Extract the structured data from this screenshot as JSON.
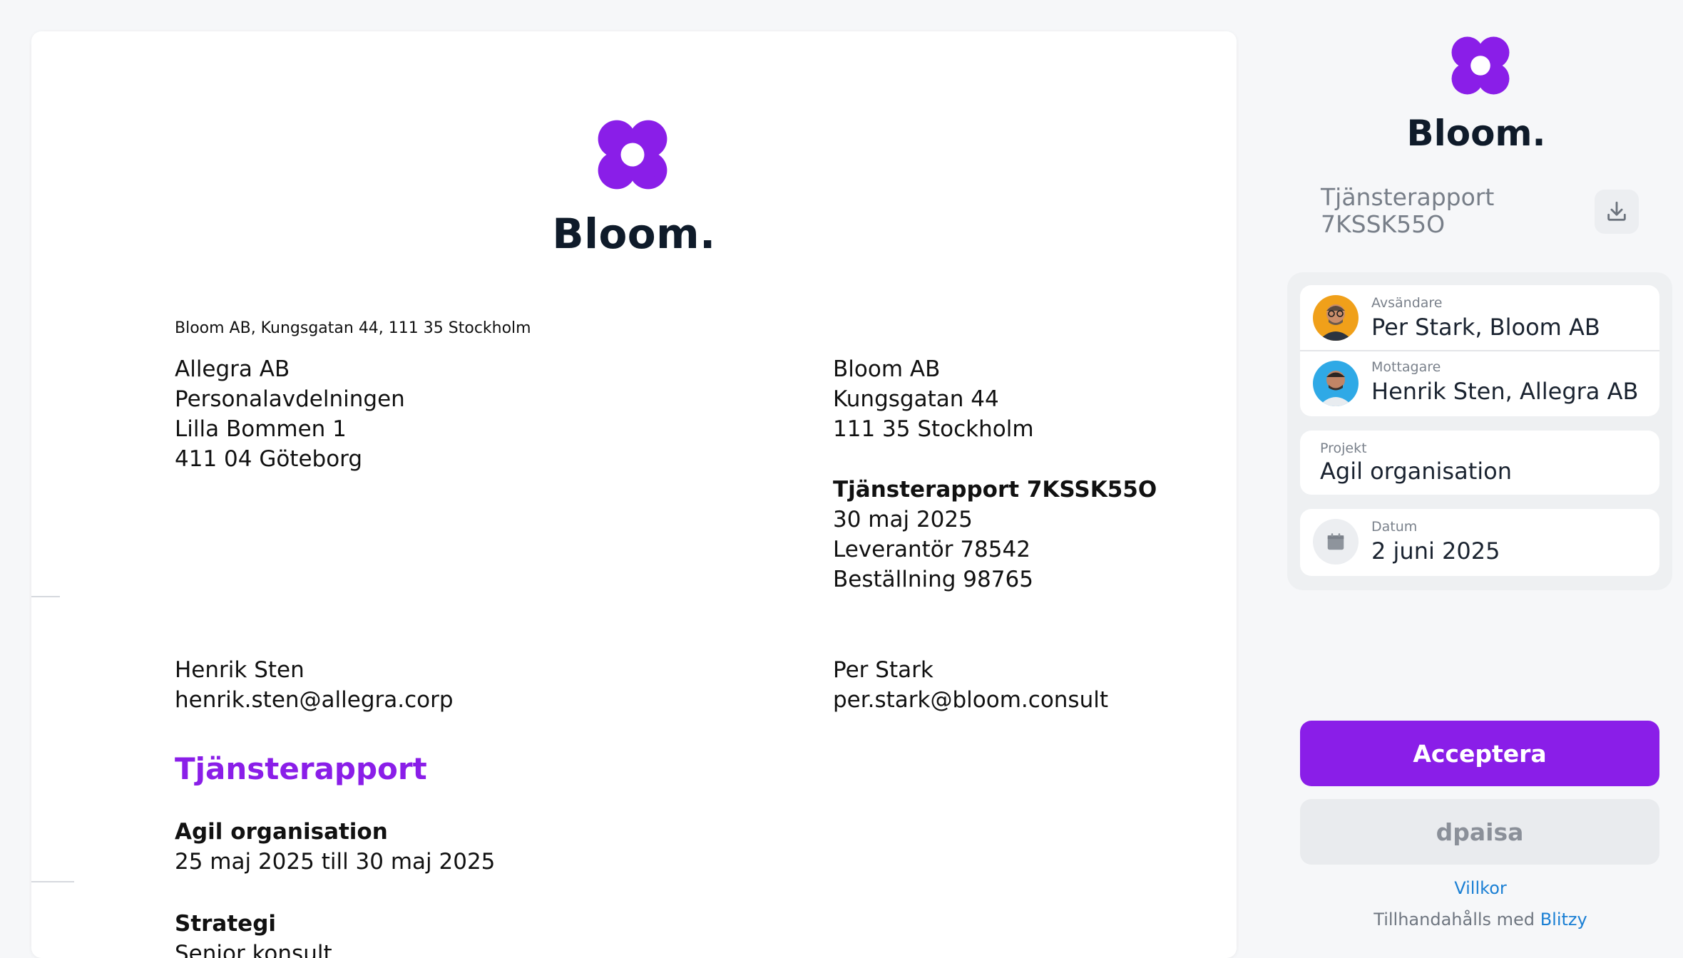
{
  "document": {
    "brand": "Bloom.",
    "sender_line": "Bloom AB, Kungsgatan 44, 111 35 Stockholm",
    "recipient_address": [
      "Allegra AB",
      "Personalavdelningen",
      "Lilla Bommen 1",
      "411 04 Göteborg"
    ],
    "sender_address": [
      "Bloom AB",
      "Kungsgatan 44",
      "111 35 Stockholm"
    ],
    "report_meta": {
      "title": "Tjänsterapport 7KSSK55O",
      "date": "30 maj 2025",
      "supplier": "Leverantör 78542",
      "order": "Beställning 98765"
    },
    "recipient_contact": {
      "name": "Henrik Sten",
      "email": "henrik.sten@allegra.corp"
    },
    "sender_contact": {
      "name": "Per Stark",
      "email": "per.stark@bloom.consult"
    },
    "heading": "Tjänsterapport",
    "project": {
      "name": "Agil organisation",
      "period": "25 maj 2025 till 30 maj 2025"
    },
    "section": {
      "name": "Strategi",
      "role": "Senior konsult"
    }
  },
  "sidebar": {
    "brand": "Bloom.",
    "doc_title_line1": "Tjänsterapport",
    "doc_title_line2": "7KSSK55O",
    "download_icon": "download-icon",
    "sender": {
      "label": "Avsändare",
      "value": "Per Stark, Bloom AB"
    },
    "recipient": {
      "label": "Mottagare",
      "value": "Henrik Sten, Allegra AB"
    },
    "project": {
      "label": "Projekt",
      "value": "Agil organisation"
    },
    "date": {
      "label": "Datum",
      "value": "2 juni 2025"
    },
    "accept_label": "Acceptera",
    "reject_label": "dpaisa",
    "terms_label": "Villkor",
    "powered_prefix": "Tillhandahålls med",
    "powered_brand": "Blitzy"
  },
  "colors": {
    "accent": "#8a1ee8",
    "brand_dark": "#0f1b2a",
    "link": "#1a7fd4"
  }
}
